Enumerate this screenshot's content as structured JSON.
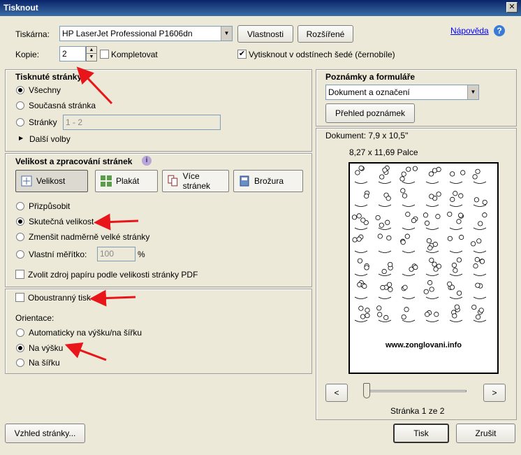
{
  "window": {
    "title": "Tisknout",
    "close_glyph": "✕"
  },
  "printer": {
    "label": "Tiskárna:",
    "selected": "HP LaserJet Professional P1606dn",
    "properties_button": "Vlastnosti",
    "advanced_button": "Rozšířené",
    "help_link": "Nápověda"
  },
  "copies": {
    "label": "Kopie:",
    "value": "2",
    "collate_label": "Kompletovat",
    "collate_checked": false,
    "grayscale_label": "Vytisknout v odstínech šedé (černobíle)",
    "grayscale_checked": true
  },
  "pages": {
    "heading": "Tisknuté stránky",
    "all_label": "Všechny",
    "current_label": "Současná stránka",
    "range_label": "Stránky",
    "range_value": "1 - 2",
    "more_options_label": "Další volby",
    "selected": "all"
  },
  "sizing": {
    "heading": "Velikost a zpracování stránek",
    "info_icon": "i",
    "tabs": [
      {
        "label": "Velikost",
        "icon": "fit-icon",
        "active": true
      },
      {
        "label": "Plakát",
        "icon": "poster-icon",
        "active": false
      },
      {
        "label": "Více stránek",
        "icon": "multiple-pages-icon",
        "active": false
      },
      {
        "label": "Brožura",
        "icon": "booklet-icon",
        "active": false
      }
    ],
    "fit_label": "Přizpůsobit",
    "actual_label": "Skutečná velikost",
    "shrink_label": "Zmenšit nadměrně velké stránky",
    "custom_label": "Vlastní měřítko:",
    "custom_value": "100",
    "percent_sign": "%",
    "selected": "actual",
    "paper_source_label": "Zvolit zdroj papíru podle velikosti stránky PDF",
    "paper_source_checked": false
  },
  "duplex": {
    "label": "Oboustranný tisk",
    "checked": false,
    "orientation_label": "Orientace:",
    "auto_label": "Automaticky na výšku/na šířku",
    "portrait_label": "Na výšku",
    "landscape_label": "Na šířku",
    "selected": "portrait"
  },
  "comments": {
    "heading": "Poznámky a formuláře",
    "selected": "Dokument a označení",
    "summary_button": "Přehled poznámek"
  },
  "preview": {
    "document_label": "Dokument: 7,9 x 10,5\"",
    "paper_label": "8,27 x 11,69 Palce",
    "watermark_text": "www.zonglovani.info",
    "prev_button": "<",
    "next_button": ">",
    "page_status": "Stránka 1 ze 2",
    "slider_fraction": 0.0
  },
  "footer": {
    "page_setup_button": "Vzhled stránky...",
    "print_button": "Tisk",
    "cancel_button": "Zrušit"
  },
  "colors": {
    "title_bar": "#0a246a",
    "annotation_arrow": "#e8151b",
    "link": "#0000ff",
    "help_icon": "#3a7bd5"
  }
}
